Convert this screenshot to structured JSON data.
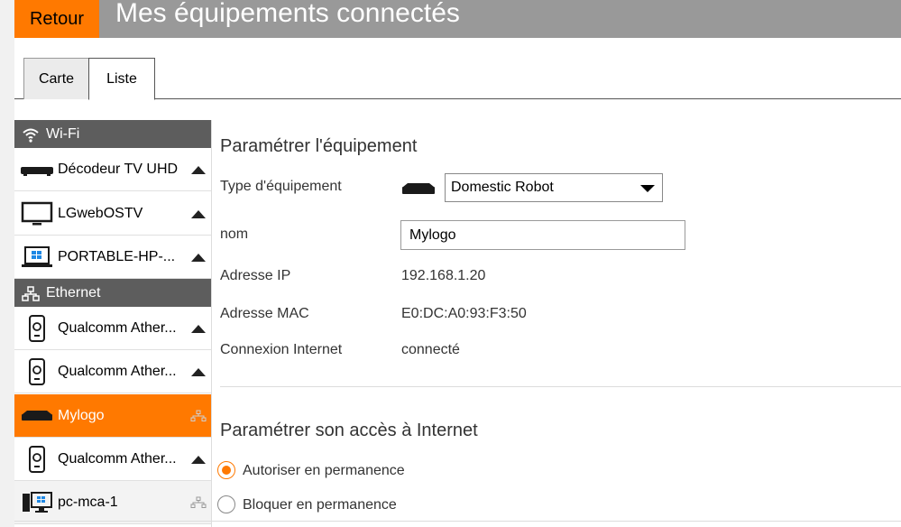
{
  "header": {
    "back_label": "Retour",
    "title": "Mes équipements connectés"
  },
  "tabs": [
    {
      "label": "Carte",
      "active": false
    },
    {
      "label": "Liste",
      "active": true
    }
  ],
  "sidebar": {
    "wifi": {
      "label": "Wi-Fi",
      "icon": "wifi-icon",
      "devices": [
        {
          "label": "Décodeur TV UHD",
          "icon": "decoder-icon"
        },
        {
          "label": "LGwebOSTV",
          "icon": "tv-icon"
        },
        {
          "label": "PORTABLE-HP-...",
          "icon": "laptop-icon"
        }
      ]
    },
    "ethernet": {
      "label": "Ethernet",
      "icon": "network-icon",
      "devices": [
        {
          "label": "Qualcomm Ather...",
          "icon": "powerline-icon"
        },
        {
          "label": "Qualcomm Ather...",
          "icon": "powerline-icon"
        },
        {
          "label": "Mylogo",
          "icon": "robot-device-icon",
          "selected": true
        },
        {
          "label": "Qualcomm Ather...",
          "icon": "powerline-icon"
        },
        {
          "label": "pc-mca-1",
          "icon": "desktop-icon"
        }
      ]
    }
  },
  "main": {
    "section1_title": "Paramétrer l'équipement",
    "type_label": "Type d'équipement",
    "type_value": "Domestic Robot",
    "name_label": "nom",
    "name_value": "Mylogo",
    "ip_label": "Adresse IP",
    "ip_value": "192.168.1.20",
    "mac_label": "Adresse MAC",
    "mac_value": "E0:DC:A0:93:F3:50",
    "conn_label": "Connexion Internet",
    "conn_value": "connecté",
    "section2_title": "Paramétrer son accès à Internet",
    "radio_allow": "Autoriser en permanence",
    "radio_block": "Bloquer en permanence"
  },
  "colors": {
    "accent": "#ff7900",
    "header_gray": "#999999",
    "section_gray": "#5d5d5d"
  }
}
